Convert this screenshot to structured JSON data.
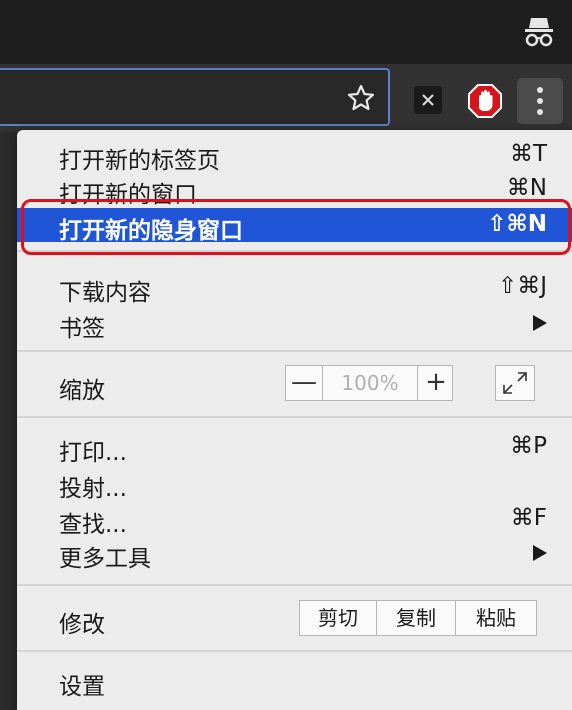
{
  "topbar": {
    "icon": "incognito-icon"
  },
  "toolbar": {
    "star_icon": "star-icon",
    "extensions": [
      "x-extension-icon",
      "adblock-icon"
    ],
    "menu_icon": "more-vert-icon"
  },
  "menu": {
    "items": [
      {
        "label": "打开新的标签页",
        "shortcut": "⌘T"
      },
      {
        "label": "打开新的窗口",
        "shortcut": "⌘N"
      },
      {
        "label": "打开新的隐身窗口",
        "shortcut": "⇧⌘N"
      }
    ],
    "downloads": {
      "label": "下载内容",
      "shortcut": "⇧⌘J"
    },
    "bookmarks": {
      "label": "书签"
    },
    "zoom": {
      "label": "缩放",
      "minus": "—",
      "value": "100%",
      "plus": "+"
    },
    "print": {
      "label": "打印...",
      "shortcut": "⌘P"
    },
    "cast": {
      "label": "投射..."
    },
    "find": {
      "label": "查找...",
      "shortcut": "⌘F"
    },
    "more_tools": {
      "label": "更多工具"
    },
    "edit": {
      "label": "修改",
      "cut": "剪切",
      "copy": "复制",
      "paste": "粘贴"
    },
    "settings": {
      "label": "设置"
    }
  },
  "colors": {
    "highlight": "#1f55d6",
    "annotation": "#e0101a",
    "menu_bg": "#ececec"
  }
}
